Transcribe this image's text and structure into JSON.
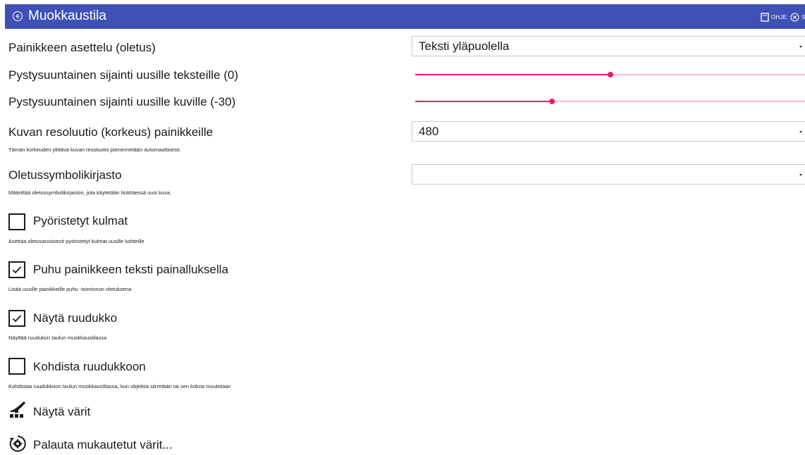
{
  "app_bar": {
    "title": "Muokkaustila",
    "help_label": "OHJE",
    "close_label": "SU"
  },
  "settings": {
    "button_layout": {
      "label": "Painikkeen asettelu (oletus)",
      "selected": "Teksti yläpuolella"
    },
    "text_position": {
      "label": "Pystysuuntainen sijainti uusille teksteille (0)",
      "value_fraction": 0.5
    },
    "image_position": {
      "label": "Pystysuuntainen sijainti uusille kuville (-30)",
      "value_fraction": 0.35
    },
    "image_resolution": {
      "label": "Kuvan resoluutio (korkeus) painikkeille",
      "selected": "480",
      "description": "Tämän korkeuden ylittävä kuvan resoluutio pienennetään automaattisesti."
    },
    "symbol_library": {
      "label": "Oletussymbolikirjasto",
      "selected": "",
      "description": "Määrittää oletussymbolikirjaston, jota käytetään lisättäessä uusi kuva."
    },
    "rounded_corners": {
      "label": "Pyöristetyt kulmat",
      "checked": false,
      "description": "Asettaa oletusarvoisesti pyöristetyt kulmat uusille kohteille"
    },
    "speak_text": {
      "label": "Puhu painikkeen teksti painalluksella",
      "checked": true,
      "description": "Lisää uusille painikkeille puhu -toiminnon oletuksena"
    },
    "show_grid": {
      "label": "Näytä ruudukko",
      "checked": true,
      "description": "Näyttää ruudukon taulun muokkaustilassa"
    },
    "snap_grid": {
      "label": "Kohdista ruudukkoon",
      "checked": false,
      "description": "Kohdistaa ruudukkoon taulun muokkaustilassa, kun objektia siirretään tai sen kokoa muutetaan"
    },
    "show_colors": {
      "label": "Näytä värit",
      "icon": "paint-palette-icon"
    },
    "reset_colors": {
      "label": "Palauta mukautetut värit...",
      "icon": "reset-gear-icon"
    }
  },
  "colors": {
    "app_bar": "#3f51b5",
    "slider_accent": "#e91e63",
    "slider_track": "#f8bbd0"
  }
}
